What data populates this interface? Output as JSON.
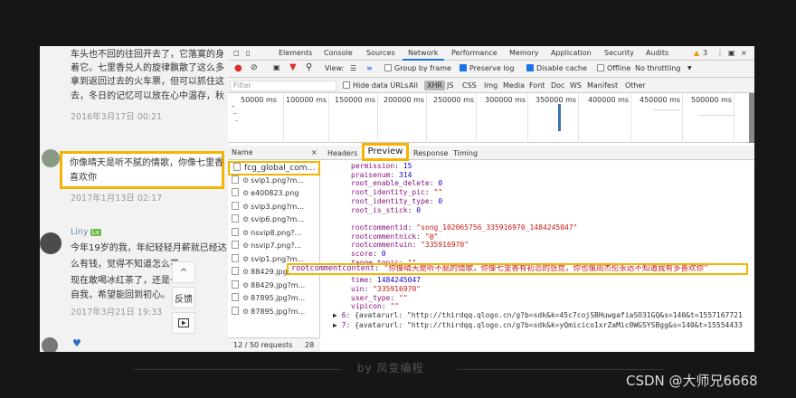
{
  "comments": {
    "top_lines": [
      "车头也不回的往回开去了，它落寞的身",
      "着它。七里香兑人的旋律飘散了这么多",
      "拿到返回过去的火车票，但可以抓住这",
      "去，冬日的记忆可以放在心中温存，秋"
    ],
    "top_date": "2016年3月17日 00:21",
    "hl_lines": [
      "你像晴天是听不腻的情歌，你像七里香",
      "喜欢你"
    ],
    "hl_date": "2017年1月13日 02:17",
    "user": "Liny",
    "user_badge": "Lv",
    "third_lines": [
      "今年19岁的我，年纪轻轻月薪就已经达",
      "么有钱，觉得不知道怎么花",
      "现在敢喝冰红茶了，还是一",
      "自我，希望能回到初心。"
    ],
    "third_date": "2017年3月21日 19:33",
    "side_up": "^",
    "side_feedback": "反馈"
  },
  "devtools": {
    "tabs": [
      "Elements",
      "Console",
      "Sources",
      "Network",
      "Performance",
      "Memory",
      "Application",
      "Security",
      "Audits"
    ],
    "warning_count": "3",
    "toolbar": {
      "view": "View:",
      "group_by_frame": "Group by frame",
      "preserve_log": "Preserve log",
      "disable_cache": "Disable cache",
      "offline": "Offline",
      "throttling": "No throttling"
    },
    "filter": {
      "placeholder": "Filter",
      "hide_data_urls": "Hide data URLs",
      "types": [
        "All",
        "XHR",
        "JS",
        "CSS",
        "Img",
        "Media",
        "Font",
        "Doc",
        "WS",
        "Manifest",
        "Other"
      ]
    },
    "timeline_ticks": [
      "50000 ms",
      "100000 ms",
      "150000 ms",
      "200000 ms",
      "250000 ms",
      "300000 ms",
      "350000 ms",
      "400000 ms",
      "450000 ms",
      "500000 ms"
    ],
    "requests": {
      "header": "Name",
      "items": [
        "fcg_global_com...",
        "svip1.png?m...",
        "e400823.png",
        "svip3.png?m...",
        "svip6.png?m...",
        "nsvip8.png?...",
        "nsvip7.png?...",
        "svip1.png?m...",
        "88429.jpg?m...",
        "88429.jpg?m...",
        "87895.jpg?m...",
        "87895.jpg?m..."
      ],
      "footer": "12 / 50 requests",
      "footer_size": "28"
    },
    "detail_tabs": [
      "Headers",
      "Preview",
      "Response",
      "Timing"
    ],
    "close": "×",
    "json_lines": [
      {
        "k": "permission",
        "v": "15",
        "t": "n"
      },
      {
        "k": "praisenum",
        "v": "314",
        "t": "n"
      },
      {
        "k": "root_enable_delete",
        "v": "0",
        "t": "n"
      },
      {
        "k": "root_identity_pic",
        "v": "\"\"",
        "t": "s"
      },
      {
        "k": "root_identity_type",
        "v": "0",
        "t": "n"
      },
      {
        "k": "root_is_stick",
        "v": "0",
        "t": "n"
      },
      {
        "k": "rootcommentcontent",
        "v": "\"你像晴天是听不腻的情歌，你像七里香有初恋的感觉，你也像周杰伦永远不知道我有多喜欢你\"",
        "t": "s"
      },
      {
        "k": "rootcommentid",
        "v": "\"song_102065756_335916970_1484245047\"",
        "t": "s"
      },
      {
        "k": "rootcommentnick",
        "v": "\"@\"",
        "t": "s"
      },
      {
        "k": "rootcommentuin",
        "v": "\"335916970\"",
        "t": "s"
      },
      {
        "k": "score",
        "v": "0",
        "t": "n"
      },
      {
        "k": "taoge_topic",
        "v": "\"\"",
        "t": "s"
      },
      {
        "k": "taoge_url",
        "v": "\"\"",
        "t": "s"
      },
      {
        "k": "time",
        "v": "1484245047",
        "t": "n"
      },
      {
        "k": "uin",
        "v": "\"335916970\"",
        "t": "s"
      },
      {
        "k": "user_type",
        "v": "\"\"",
        "t": "s"
      },
      {
        "k": "vipicon",
        "v": "\"\"",
        "t": "s"
      }
    ],
    "array_lines": [
      {
        "idx": "6",
        "text": "{avatarurl: \"http://thirdqq.qlogo.cn/g?b=sdk&k=45c7cojSBHuwgafiaSO31GQ&s=140&t=1557167721"
      },
      {
        "idx": "7",
        "text": "{avatarurl: \"http://thirdqq.qlogo.cn/g?b=sdk&k=yQmicico1xrZaMic0WGSYSBgg&s=140&t=15554433"
      }
    ]
  },
  "footer": {
    "credit": "by 风变编程",
    "watermark": "CSDN @大师兄6668"
  },
  "colors": {
    "highlight": "#f4b400",
    "json_key": "#881280",
    "json_string": "#c41a16",
    "json_number": "#1c00cf",
    "network_active": "#1a73e8"
  }
}
